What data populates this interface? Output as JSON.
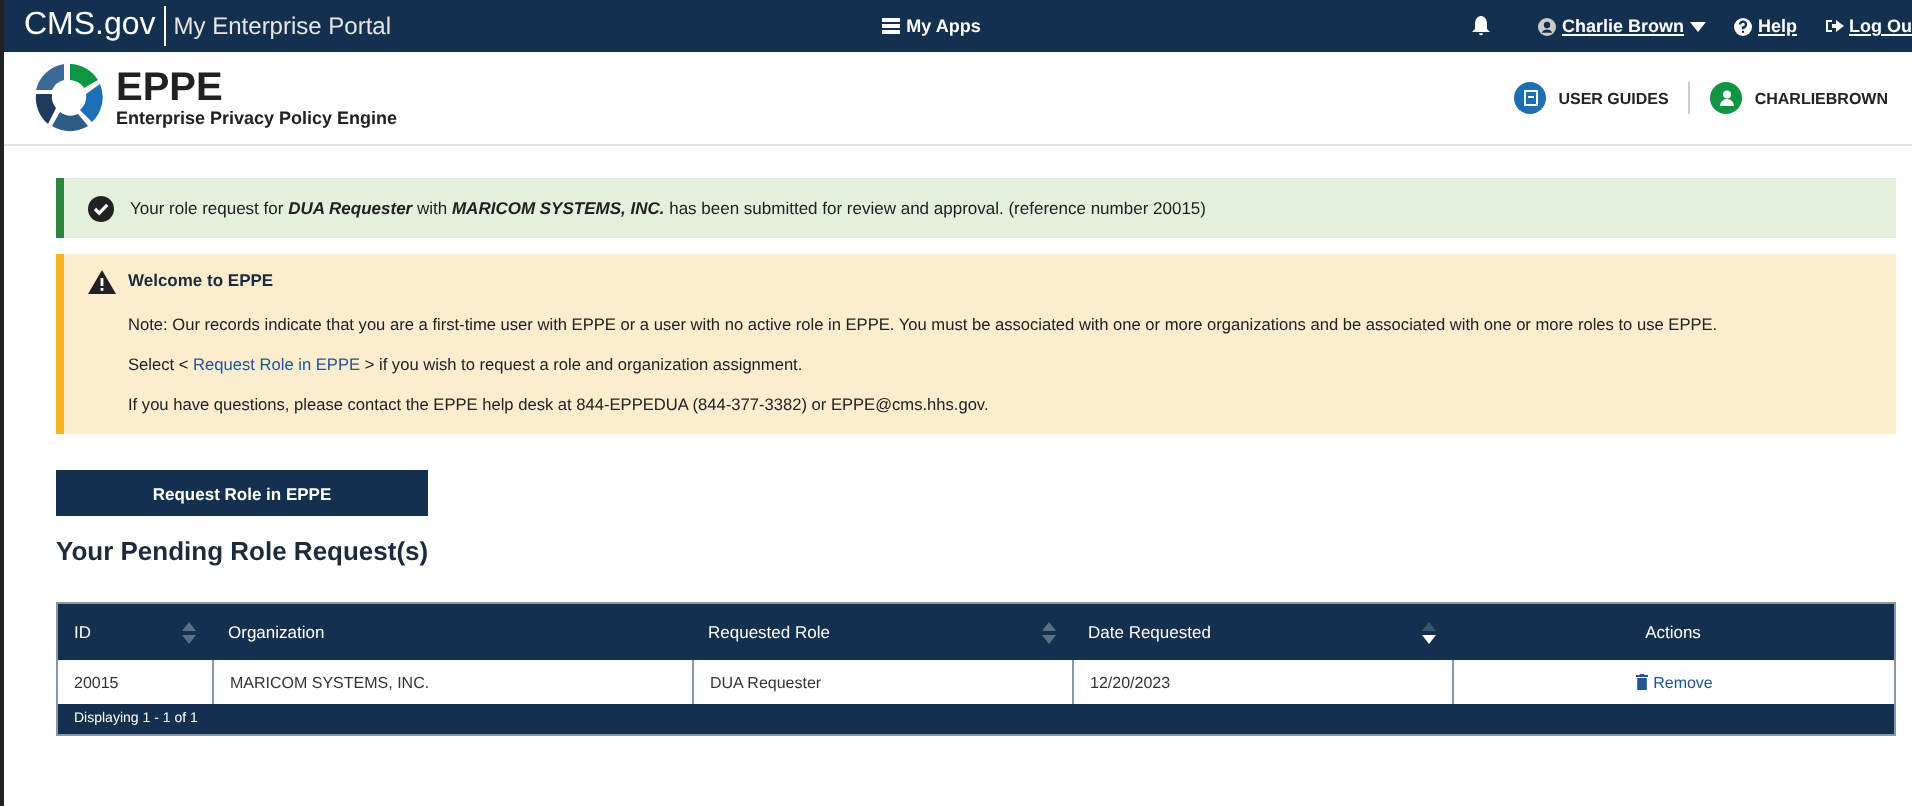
{
  "top_bar": {
    "brand": "CMS.gov",
    "portal": "My Enterprise Portal",
    "apps": "My Apps",
    "user": "Charlie Brown",
    "help": "Help",
    "logout": "Log Ou"
  },
  "header": {
    "title": "EPPE",
    "subtitle": "Enterprise Privacy Policy Engine",
    "guides": "USER GUIDES",
    "account": "CHARLIEBROWN"
  },
  "success_alert": {
    "text": "Your role request for *DUA Requester* with *MARICOM SYSTEMS, INC.* has been submitted for review and approval. (reference number 20015)"
  },
  "warning_alert": {
    "title": "Welcome to EPPE",
    "note": "Note: Our records indicate that you are a first-time user with EPPE or a user with no active role in EPPE. You must be associated with one or more organizations and be associated with one or more roles to use EPPE.",
    "select_before": "Select <",
    "select_link": "Request Role in EPPE",
    "select_after": "> if you wish to request a role and organization assignment.",
    "contact": "If you have questions, please contact the EPPE help desk at 844-EPPEDUA (844-377-3382) or EPPE@cms.hhs.gov."
  },
  "request_button": "Request Role in EPPE",
  "section_title": "Your Pending Role Request(s)",
  "table": {
    "columns": [
      {
        "label": "ID",
        "sortable": true,
        "sorted": false
      },
      {
        "label": "Organization",
        "sortable": false
      },
      {
        "label": "Requested Role",
        "sortable": true,
        "sorted": false
      },
      {
        "label": "Date Requested",
        "sortable": true,
        "sorted": true
      },
      {
        "label": "Actions",
        "sortable": false
      }
    ],
    "rows": [
      {
        "id": "20015",
        "organization": "MARICOM SYSTEMS, INC.",
        "role": "DUA Requester",
        "date": "12/20/2023",
        "action": "Remove"
      }
    ],
    "footer": "Displaying 1 - 1 of 1"
  }
}
